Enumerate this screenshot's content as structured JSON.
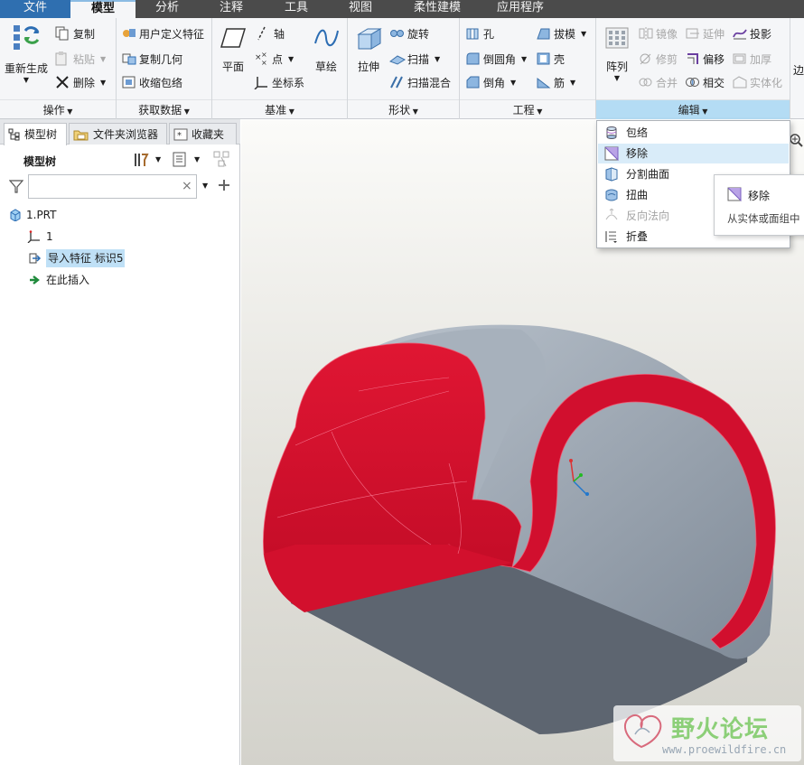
{
  "menu": {
    "tabs": [
      "文件",
      "模型",
      "分析",
      "注释",
      "工具",
      "视图",
      "柔性建模",
      "应用程序"
    ],
    "active_index": 1
  },
  "ribbon": {
    "operations": {
      "label": "操作",
      "regenerate": "重新生成",
      "copy": "复制",
      "paste": "粘贴",
      "delete": "删除"
    },
    "get_data": {
      "label": "获取数据",
      "udf": "用户定义特征",
      "copy_geom": "复制几何",
      "shrinkwrap": "收缩包络"
    },
    "datum": {
      "label": "基准",
      "plane": "平面",
      "axis": "轴",
      "point": "点",
      "csys": "坐标系",
      "sketch": "草绘"
    },
    "shapes": {
      "label": "形状",
      "extrude": "拉伸",
      "revolve": "旋转",
      "sweep": "扫描",
      "swept_blend": "扫描混合"
    },
    "engineering": {
      "label": "工程",
      "hole": "孔",
      "round": "倒圆角",
      "chamfer": "倒角",
      "draft": "拔模",
      "shell": "壳",
      "rib": "筋"
    },
    "editing": {
      "label": "编辑",
      "pattern": "阵列",
      "mirror": "镜像",
      "extend": "延伸",
      "project": "投影",
      "trim": "修剪",
      "offset": "偏移",
      "thicken": "加厚",
      "merge": "合并",
      "intersect": "相交",
      "solidify": "实体化"
    },
    "overflow_label": "边"
  },
  "navigator": {
    "tabs": [
      "模型树",
      "文件夹浏览器",
      "收藏夹"
    ],
    "tree_title": "模型树",
    "filter_placeholder": "",
    "clear_symbol": "×",
    "items": [
      {
        "label": "1.PRT"
      },
      {
        "label": "1"
      },
      {
        "label": "导入特征 标识5"
      },
      {
        "label": "在此插入"
      }
    ]
  },
  "dropdown": {
    "items": [
      "包络",
      "移除",
      "分割曲面",
      "扭曲",
      "反向法向",
      "折叠"
    ],
    "highlighted_index": 1,
    "disabled_index": 4
  },
  "tooltip": {
    "title": "移除",
    "desc": "从实体或面组中"
  },
  "watermark": {
    "name": "野火论坛",
    "url": "www.proewildfire.cn"
  },
  "colors": {
    "accent": "#2f6fb0",
    "selection": "#bfe0f6",
    "highlight_face": "#d10f2e",
    "model_face": "#8f9aa6"
  }
}
